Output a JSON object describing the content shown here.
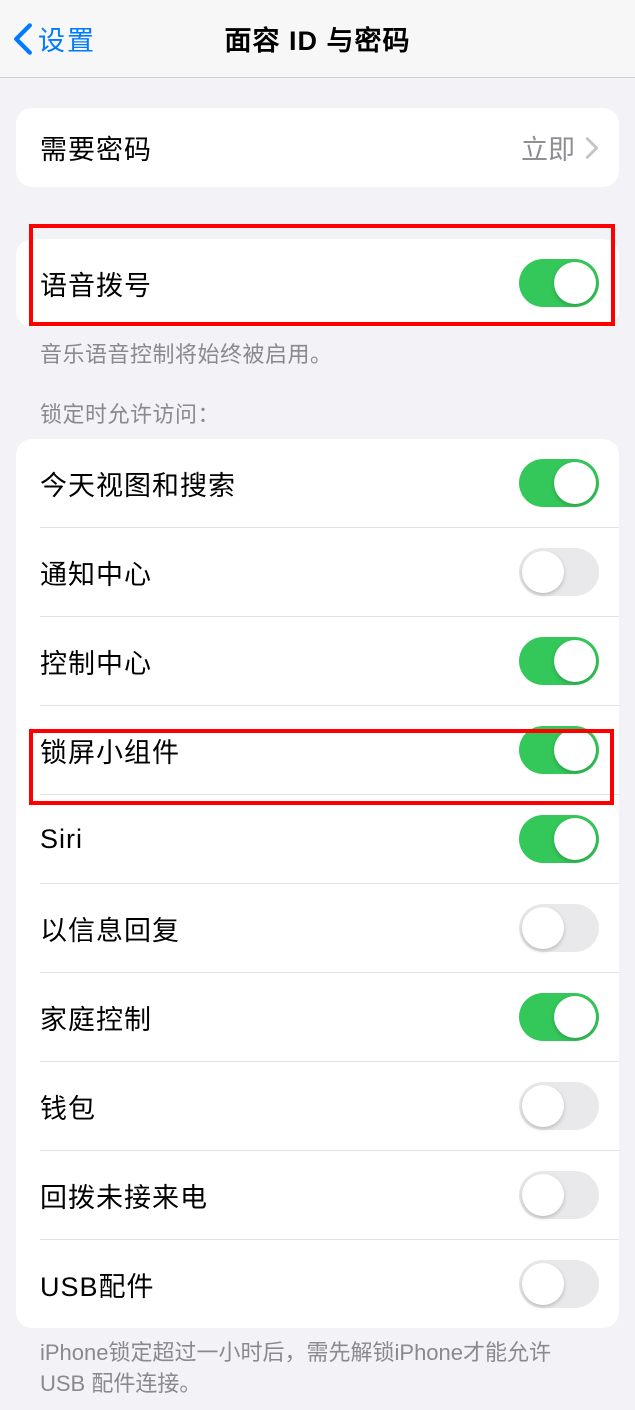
{
  "header": {
    "back_label": "设置",
    "title": "面容 ID 与密码"
  },
  "passcode_row": {
    "label": "需要密码",
    "value": "立即"
  },
  "voice_dial": {
    "label": "语音拨号",
    "footer": "音乐语音控制将始终被启用。"
  },
  "lock_access": {
    "header": "锁定时允许访问：",
    "items": [
      {
        "label": "今天视图和搜索",
        "on": true
      },
      {
        "label": "通知中心",
        "on": false
      },
      {
        "label": "控制中心",
        "on": true
      },
      {
        "label": "锁屏小组件",
        "on": true
      },
      {
        "label": "Siri",
        "on": true
      },
      {
        "label": "以信息回复",
        "on": false
      },
      {
        "label": "家庭控制",
        "on": true
      },
      {
        "label": "钱包",
        "on": false
      },
      {
        "label": "回拨未接来电",
        "on": false
      },
      {
        "label": "USB配件",
        "on": false
      }
    ],
    "footer": "iPhone锁定超过一小时后，需先解锁iPhone才能允许USB 配件连接。"
  }
}
